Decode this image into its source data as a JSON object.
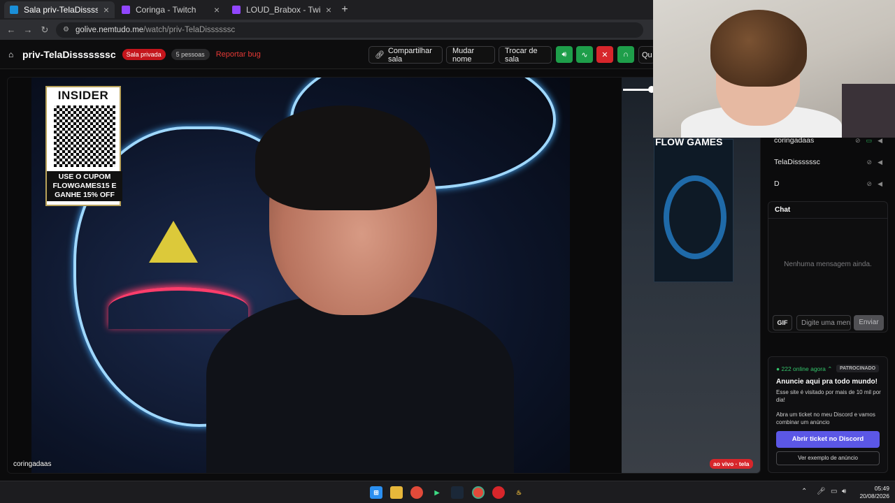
{
  "tabs": [
    {
      "label": "Sala priv-TelaDissssssc | GoLive",
      "active": true,
      "favicon_color": "#1a8fd8"
    },
    {
      "label": "Coringa - Twitch",
      "active": false,
      "favicon_color": "#9146ff"
    },
    {
      "label": "LOUD_Brabox - Twitch",
      "active": false,
      "favicon_color": "#9146ff"
    }
  ],
  "address": {
    "host": "golive.nemtudo.me",
    "path": "/watch/priv-TelaDissssssc"
  },
  "header": {
    "room_name": "priv-TelaDisssssssc",
    "private_badge": "Sala privada",
    "people_badge": "5 pessoas",
    "report_bug": "Reportar bug",
    "share": "Compartilhar sala",
    "rename": "Mudar nome",
    "switch_room": "Trocar de sala",
    "cut_label": "Qu"
  },
  "video": {
    "promo_brand": "INSIDER",
    "promo_text": "USE O CUPOM FLOWGAMES15 E GANHE 15% OFF",
    "side_logo": "FLOW GAMES",
    "streamer_label": "coringadaas",
    "live_badge": "ao vivo · tela"
  },
  "participants": [
    {
      "name": "coringadaas",
      "screen_on": true
    },
    {
      "name": "TelaDissssssc",
      "screen_on": false
    },
    {
      "name": "D",
      "screen_on": false
    }
  ],
  "chat": {
    "title": "Chat",
    "empty": "Nenhuma mensagem ainda.",
    "gif": "GIF",
    "placeholder": "Digite uma mensagem",
    "send": "Enviar"
  },
  "ad": {
    "online": "● 222 online agora ⌃",
    "sponsored": "PATROCINADO",
    "title": "Anuncie aqui pra todo mundo!",
    "sub": "Esse site é visitado por mais de 10 mil por dia!",
    "text": "Abra um ticket no meu Discord e vamos combinar um anúncio",
    "discord_btn": "Abrir ticket no Discord",
    "example_btn": "Ver exemplo de anúncio"
  },
  "clock": {
    "time": "05:49",
    "date": "20/08/2026"
  },
  "colors": {
    "accent_green": "#1e9e4a",
    "accent_red": "#d7262b",
    "discord": "#5b57e6"
  }
}
